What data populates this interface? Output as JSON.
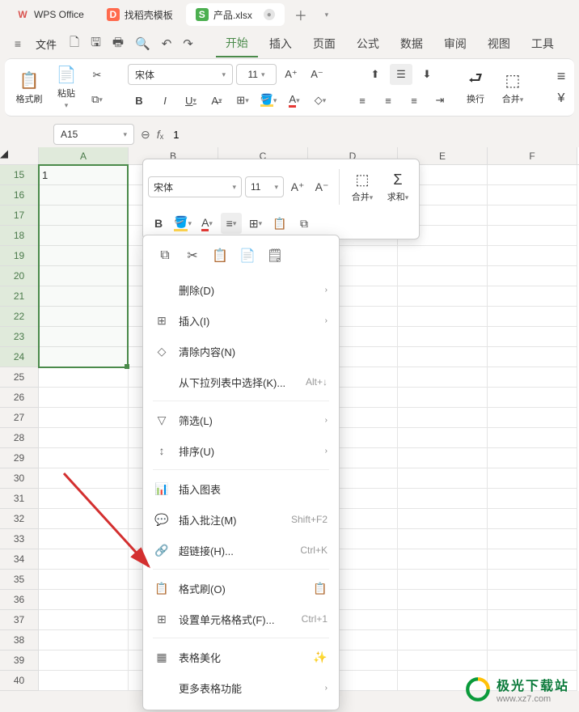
{
  "tabs": [
    {
      "label": "WPS Office",
      "iconColor": "#d9534f",
      "iconText": "W"
    },
    {
      "label": "找稻壳模板",
      "iconColor": "#ff6a4d",
      "iconText": "D"
    },
    {
      "label": "产品.xlsx",
      "iconColor": "#4caf50",
      "iconText": "S",
      "active": true
    }
  ],
  "fileLabel": "文件",
  "menuTabs": [
    "开始",
    "插入",
    "页面",
    "公式",
    "数据",
    "审阅",
    "视图",
    "工具"
  ],
  "activeMenuTab": "开始",
  "ribbon": {
    "formatPainter": "格式刷",
    "paste": "粘贴",
    "font": "宋体",
    "fontSize": "11",
    "wrap": "换行",
    "mergeCenter": "合并",
    "currency": "¥"
  },
  "nameBox": "A15",
  "formula": "1",
  "columns": [
    "A",
    "B",
    "C",
    "D",
    "E",
    "F"
  ],
  "rowStart": 15,
  "rowEnd": 40,
  "cellA15": "1",
  "miniToolbar": {
    "font": "宋体",
    "size": "11",
    "merge": "合并",
    "sum": "求和"
  },
  "ctx": {
    "delete": "删除(D)",
    "insert": "插入(I)",
    "clear": "清除内容(N)",
    "fromList": "从下拉列表中选择(K)...",
    "fromListSc": "Alt+↓",
    "filter": "筛选(L)",
    "sort": "排序(U)",
    "insertChart": "插入图表",
    "insertComment": "插入批注(M)",
    "insertCommentSc": "Shift+F2",
    "hyperlink": "超链接(H)...",
    "hyperlinkSc": "Ctrl+K",
    "formatPainter": "格式刷(O)",
    "formatCells": "设置单元格格式(F)...",
    "formatCellsSc": "Ctrl+1",
    "tableBeautify": "表格美化",
    "moreTable": "更多表格功能"
  },
  "watermark": {
    "title": "极光下载站",
    "url": "www.xz7.com"
  }
}
